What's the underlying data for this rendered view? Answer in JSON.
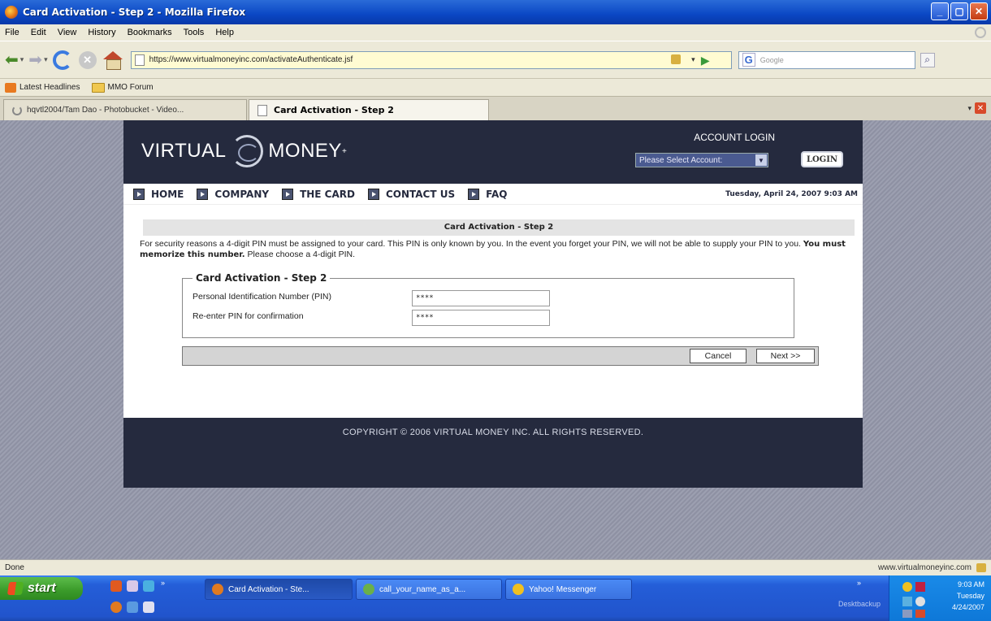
{
  "browser": {
    "window_title": "Card Activation - Step 2 - Mozilla Firefox",
    "menu": [
      "File",
      "Edit",
      "View",
      "History",
      "Bookmarks",
      "Tools",
      "Help"
    ],
    "url": "https://www.virtualmoneyinc.com/activateAuthenticate.jsf",
    "search_placeholder": "Google",
    "bookmarks": [
      "Latest Headlines",
      "MMO Forum"
    ],
    "tabs": [
      {
        "label": "hqvtl2004/Tam Dao - Photobucket - Video...",
        "active": false
      },
      {
        "label": "Card Activation - Step 2",
        "active": true
      }
    ],
    "status_left": "Done",
    "status_right": "www.virtualmoneyinc.com"
  },
  "site": {
    "logo_left": "VIRTUAL",
    "logo_right": "MONEY",
    "logo_mark": "+",
    "account_login_label": "ACCOUNT LOGIN",
    "account_select_value": "Please Select Account:",
    "login_button": "LOGIN",
    "nav": [
      "HOME",
      "COMPANY",
      "THE CARD",
      "CONTACT US",
      "FAQ"
    ],
    "date": "Tuesday, April 24, 2007 9:03 AM",
    "step_title": "Card Activation - Step 2",
    "intro_part1": "For security reasons a 4-digit PIN must be assigned to your card. This PIN is only known by you. In the event you forget your PIN, we will not be able to supply your PIN to you.",
    "intro_bold": "You must memorize this number.",
    "intro_part2": "Please choose a 4-digit PIN.",
    "form_legend": "Card Activation - Step 2",
    "pin_label": "Personal Identification Number (PIN)",
    "pin_value": "****",
    "reenter_label": "Re-enter PIN for confirmation",
    "reenter_value": "****",
    "cancel_button": "Cancel",
    "next_button": "Next >>",
    "copyright": "COPYRIGHT © 2006 VIRTUAL MONEY INC. ALL RIGHTS RESERVED."
  },
  "taskbar": {
    "start_label": "start",
    "tasks": [
      {
        "label": "Card Activation - Ste...",
        "active": true
      },
      {
        "label": "call_your_name_as_a...",
        "active": false
      },
      {
        "label": "Yahoo! Messenger",
        "active": false
      }
    ],
    "desktop_label": "Desktbackup",
    "clock_time": "9:03 AM",
    "clock_day": "Tuesday",
    "clock_date": "4/24/2007"
  }
}
